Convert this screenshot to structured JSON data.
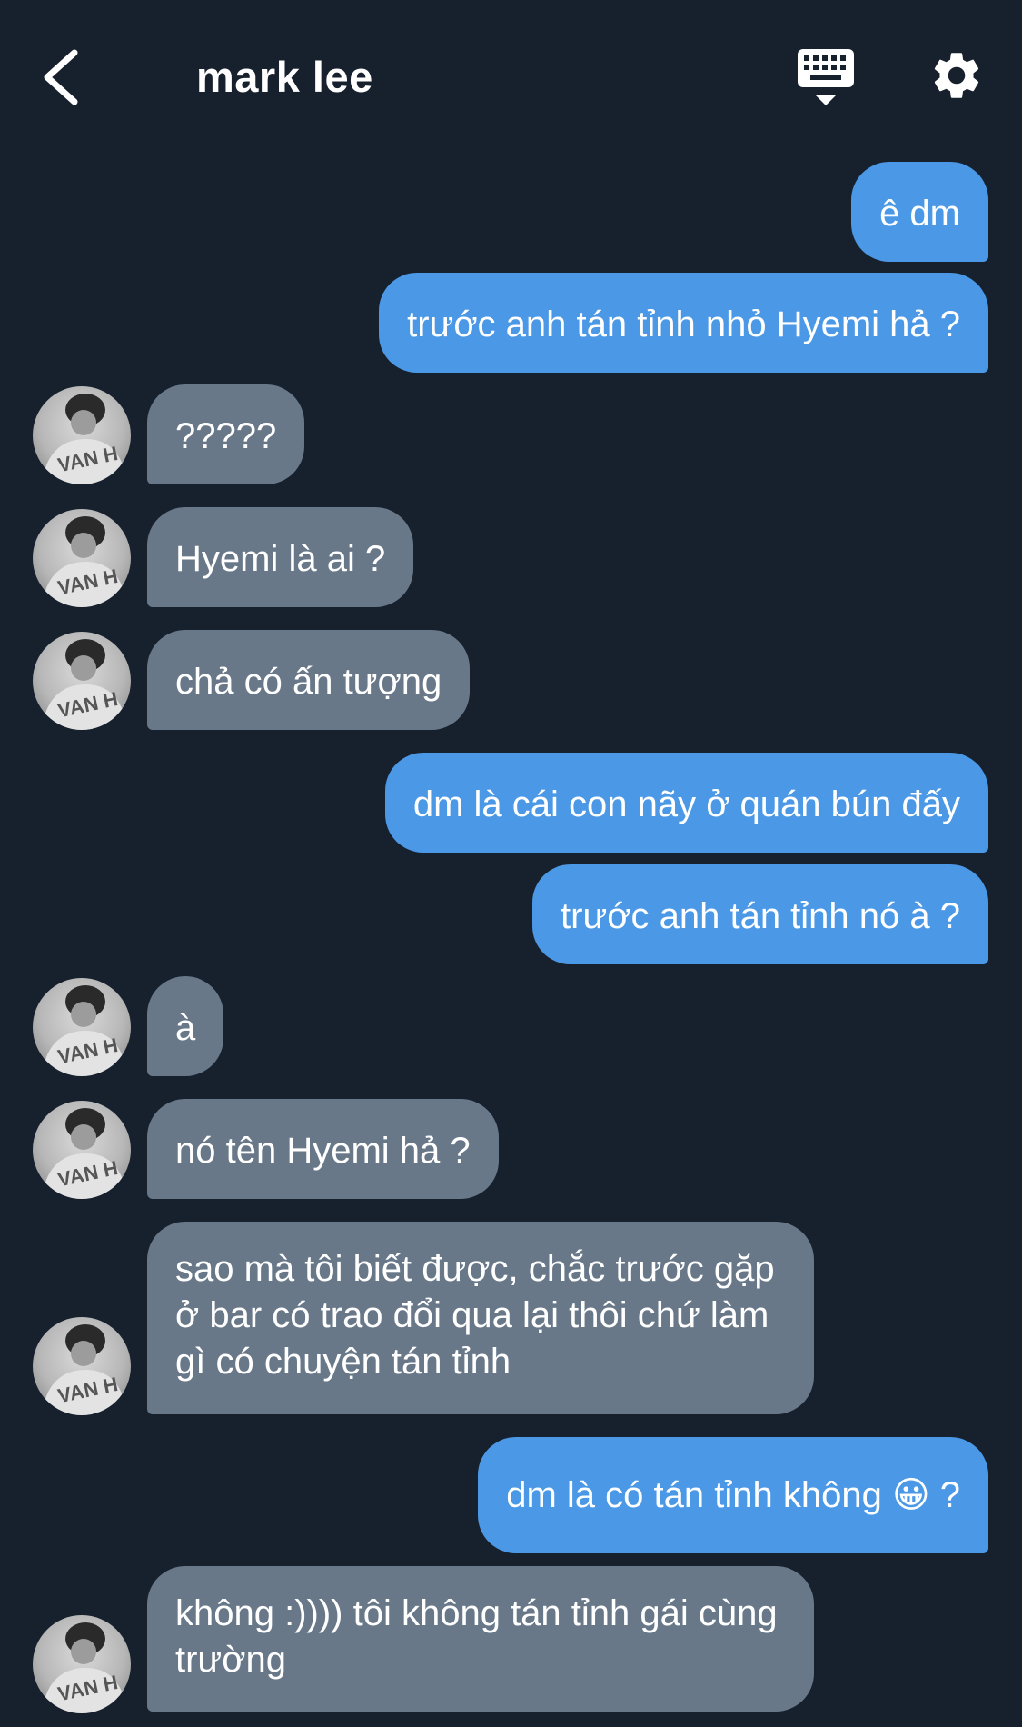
{
  "header": {
    "title": "mark lee",
    "back_icon": "chevron-left-icon",
    "keyboard_icon": "keyboard-icon",
    "settings_icon": "gear-icon"
  },
  "colors": {
    "background": "#17202d",
    "outgoing_bubble": "#4a98e6",
    "incoming_bubble": "#687889"
  },
  "messages": [
    {
      "from": "me",
      "text": "ê dm"
    },
    {
      "from": "me",
      "text": "trước anh tán tỉnh nhỏ Hyemi hả ?"
    },
    {
      "from": "them",
      "text": "?????"
    },
    {
      "from": "them",
      "text": "Hyemi là ai ?"
    },
    {
      "from": "them",
      "text": "chả có ấn tượng"
    },
    {
      "from": "me",
      "text": "dm là cái con nãy ở quán bún đấy"
    },
    {
      "from": "me",
      "text": "trước anh tán tỉnh nó à ?"
    },
    {
      "from": "them",
      "text": "à"
    },
    {
      "from": "them",
      "text": "nó tên Hyemi hả ?"
    },
    {
      "from": "them",
      "text": "sao mà tôi biết được, chắc trước gặp ở bar có trao đổi qua lại thôi chứ làm gì có chuyện tán tỉnh"
    },
    {
      "from": "me",
      "text": "dm là có tán tỉnh không 😀 ?"
    },
    {
      "from": "them",
      "text": "không :)))) tôi không tán tỉnh gái cùng trường"
    }
  ]
}
